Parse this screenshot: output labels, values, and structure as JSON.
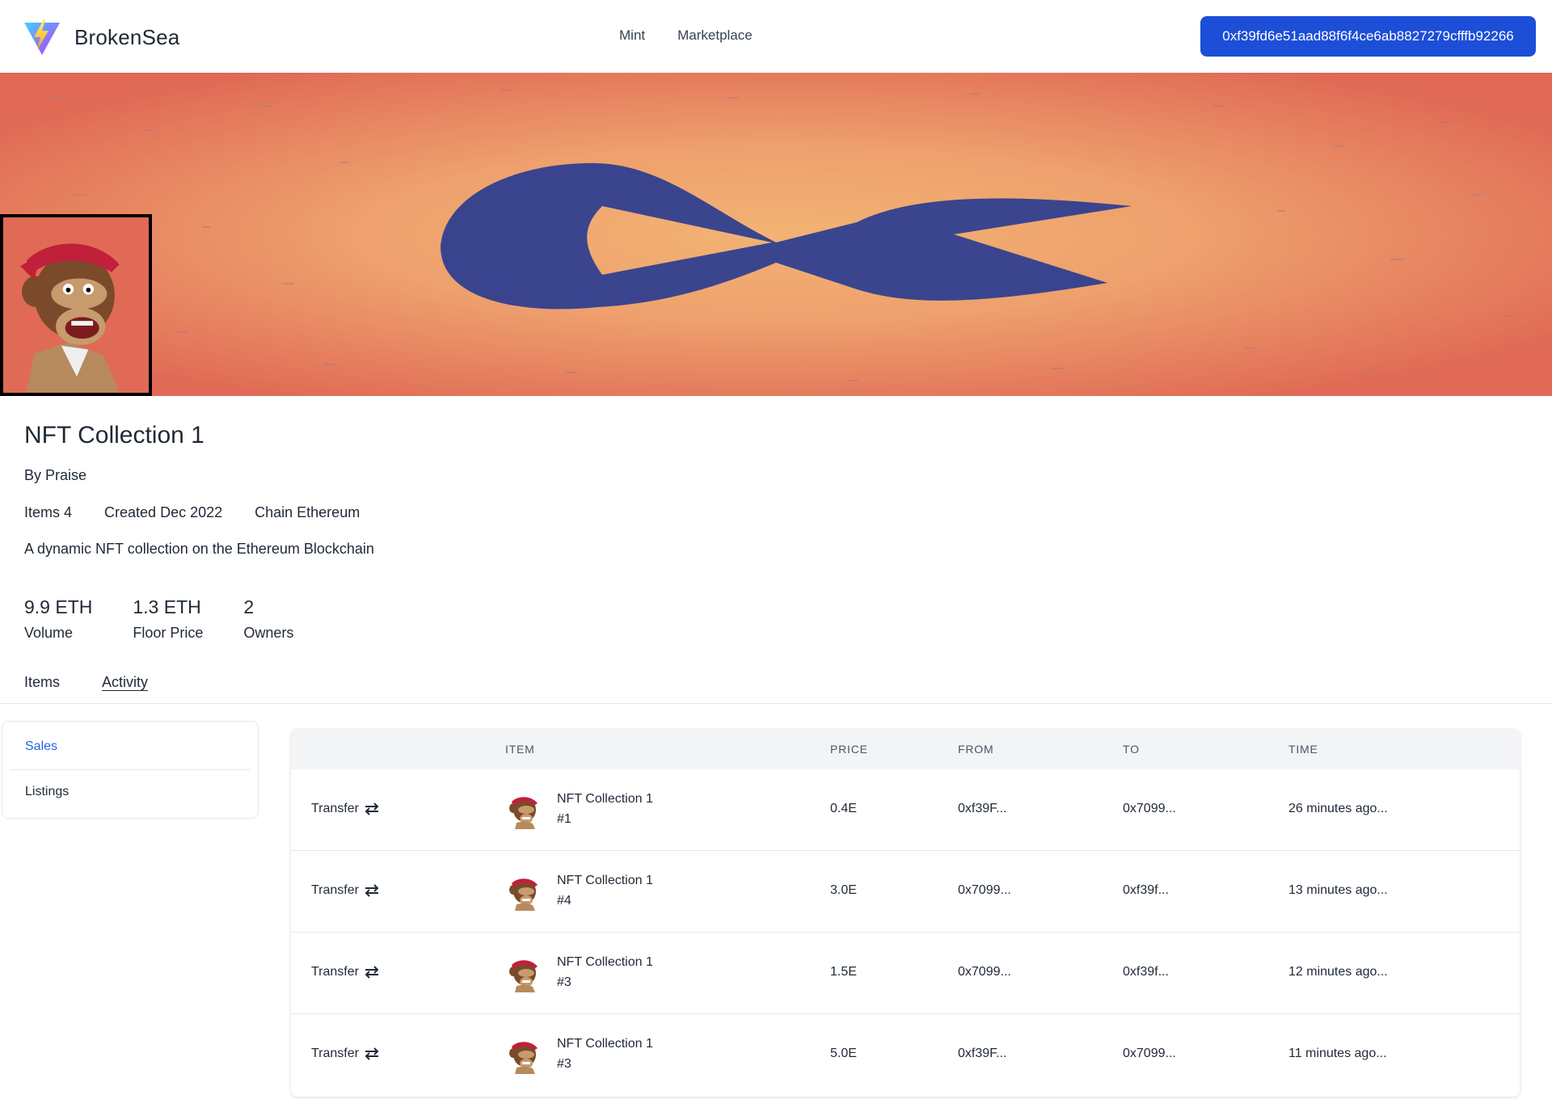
{
  "brand": {
    "name": "BrokenSea",
    "logo": "vite-logo-icon"
  },
  "nav": {
    "links": [
      "Mint",
      "Marketplace"
    ]
  },
  "wallet": {
    "address": "0xf39fd6e51aad88f6f4ce6ab8827279cfffb92266"
  },
  "collection": {
    "title": "NFT Collection 1",
    "by": "By Praise",
    "items": "Items 4",
    "created": "Created Dec 2022",
    "chain": "Chain Ethereum",
    "description": "A dynamic NFT collection on the Ethereum Blockchain"
  },
  "stats": [
    {
      "value": "9.9 ETH",
      "label": "Volume"
    },
    {
      "value": "1.3 ETH",
      "label": "Floor Price"
    },
    {
      "value": "2",
      "label": "Owners"
    }
  ],
  "tabs": [
    {
      "label": "Items",
      "active": false
    },
    {
      "label": "Activity",
      "active": true
    }
  ],
  "sidebar": {
    "items": [
      {
        "label": "Sales",
        "active": true
      },
      {
        "label": "Listings",
        "active": false
      }
    ]
  },
  "table": {
    "headers": [
      "ITEM",
      "PRICE",
      "FROM",
      "TO",
      "TIME"
    ],
    "rows": [
      {
        "event": "Transfer",
        "item_name": "NFT Collection 1",
        "item_num": "#1",
        "price": "0.4E",
        "from": "0xf39F...",
        "to": "0x7099...",
        "time": "26 minutes ago..."
      },
      {
        "event": "Transfer",
        "item_name": "NFT Collection 1",
        "item_num": "#4",
        "price": "3.0E",
        "from": "0x7099...",
        "to": "0xf39f...",
        "time": "13 minutes ago..."
      },
      {
        "event": "Transfer",
        "item_name": "NFT Collection 1",
        "item_num": "#3",
        "price": "1.5E",
        "from": "0x7099...",
        "to": "0xf39f...",
        "time": "12 minutes ago..."
      },
      {
        "event": "Transfer",
        "item_name": "NFT Collection 1",
        "item_num": "#3",
        "price": "5.0E",
        "from": "0xf39F...",
        "to": "0x7099...",
        "time": "11 minutes ago..."
      }
    ]
  },
  "colors": {
    "accent": "#1d4ed8",
    "active_link": "#2563eb",
    "banner_edge": "#e06a55",
    "banner_center": "#f3b374",
    "fish": "#2f3f8f"
  }
}
